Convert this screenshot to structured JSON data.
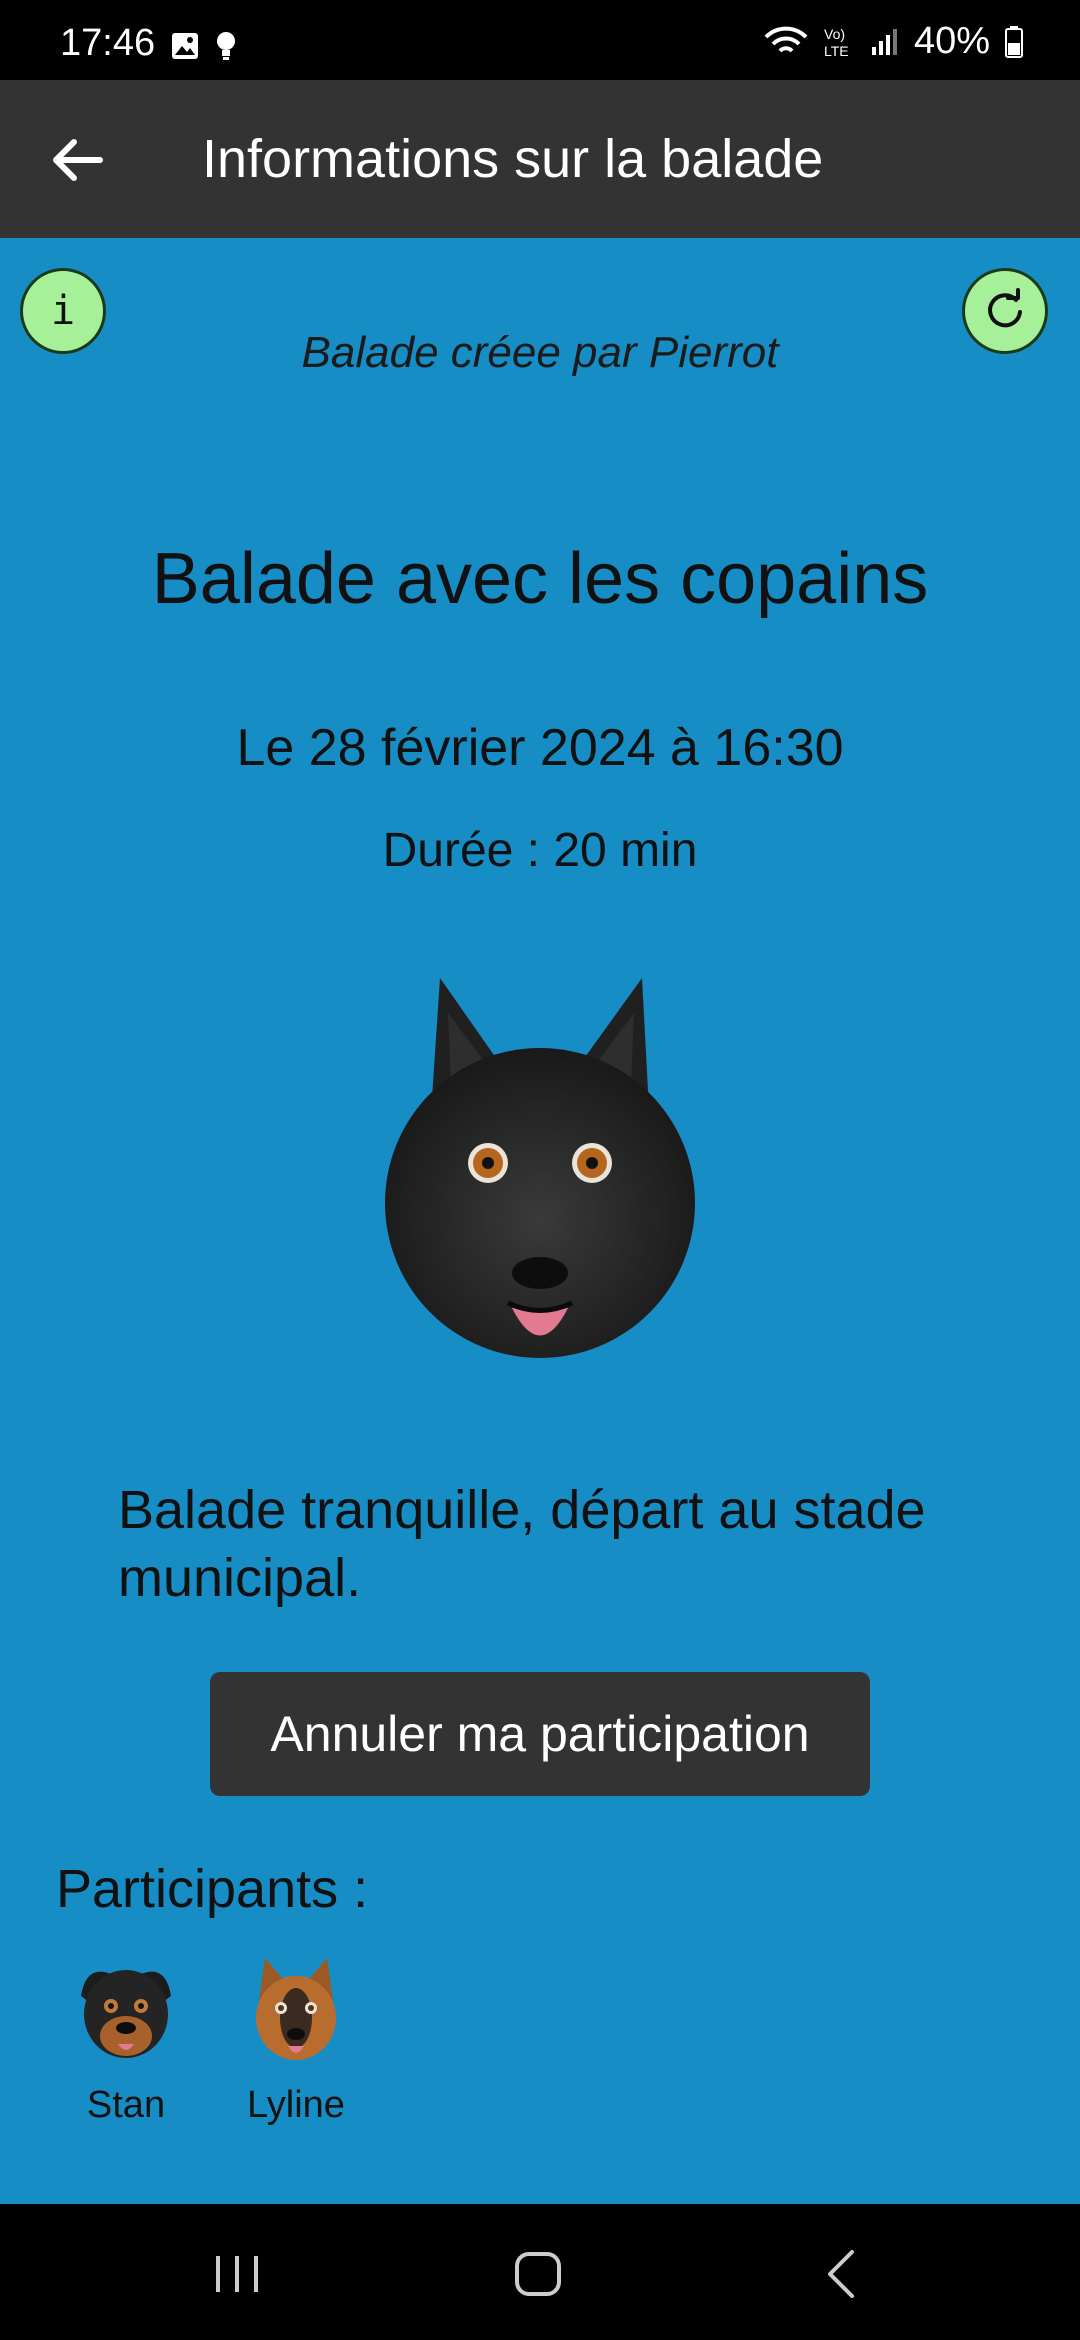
{
  "status_bar": {
    "time": "17:46",
    "battery": "40%",
    "icons": [
      "image-icon",
      "bulb-icon",
      "wifi-icon",
      "volte-icon",
      "signal-icon",
      "battery-icon"
    ]
  },
  "app_bar": {
    "title": "Informations sur la balade",
    "back_icon": "arrow-left-icon"
  },
  "walk": {
    "creator": "Balade créee par Pierrot",
    "title": "Balade avec les copains",
    "date": "Le 28 février 2024 à 16:30",
    "duration": "Durée : 20 min",
    "description": "Balade tranquille, départ au stade municipal.",
    "cancel_label": "Annuler ma participation"
  },
  "buttons": {
    "info_glyph": "i",
    "info_icon": "info-icon",
    "refresh_icon": "refresh-icon"
  },
  "participants": {
    "heading": "Participants :",
    "list": [
      {
        "name": "Stan"
      },
      {
        "name": "Lyline"
      }
    ]
  },
  "colors": {
    "background": "#178dc5",
    "app_bar": "#333333",
    "round_button": "#a6f09a",
    "cancel_button": "#333333"
  }
}
